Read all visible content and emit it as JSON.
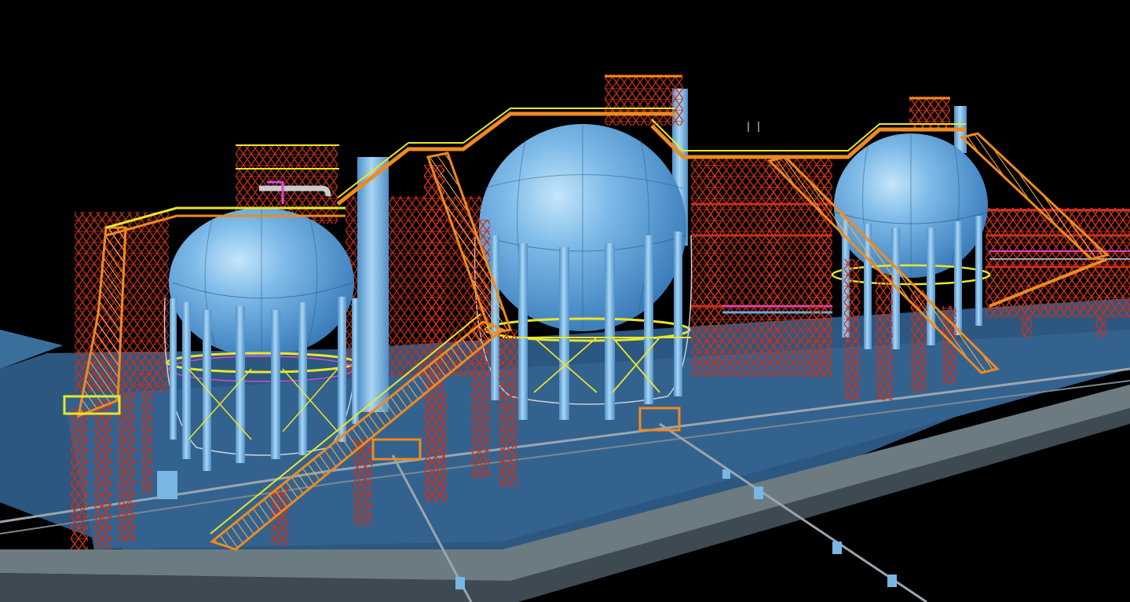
{
  "scene": {
    "description_label": "",
    "colors": {
      "background": "#000000",
      "slab": "#2f5a84",
      "slab_edge": "#6f7f86",
      "vessel": "#6aa8dc",
      "vessel_highlight": "#b9def7",
      "column": "#79b6e4",
      "steel_red": "#c8321c",
      "walkway_orange": "#f08a1e",
      "handrail_yellow": "#e9e62a",
      "pipe_grey": "#9aa6ad",
      "magenta_pipe": "#d44ad6"
    },
    "icons": [
      "sphere-tank",
      "steel-frame",
      "stairway",
      "pipe-rack"
    ]
  }
}
